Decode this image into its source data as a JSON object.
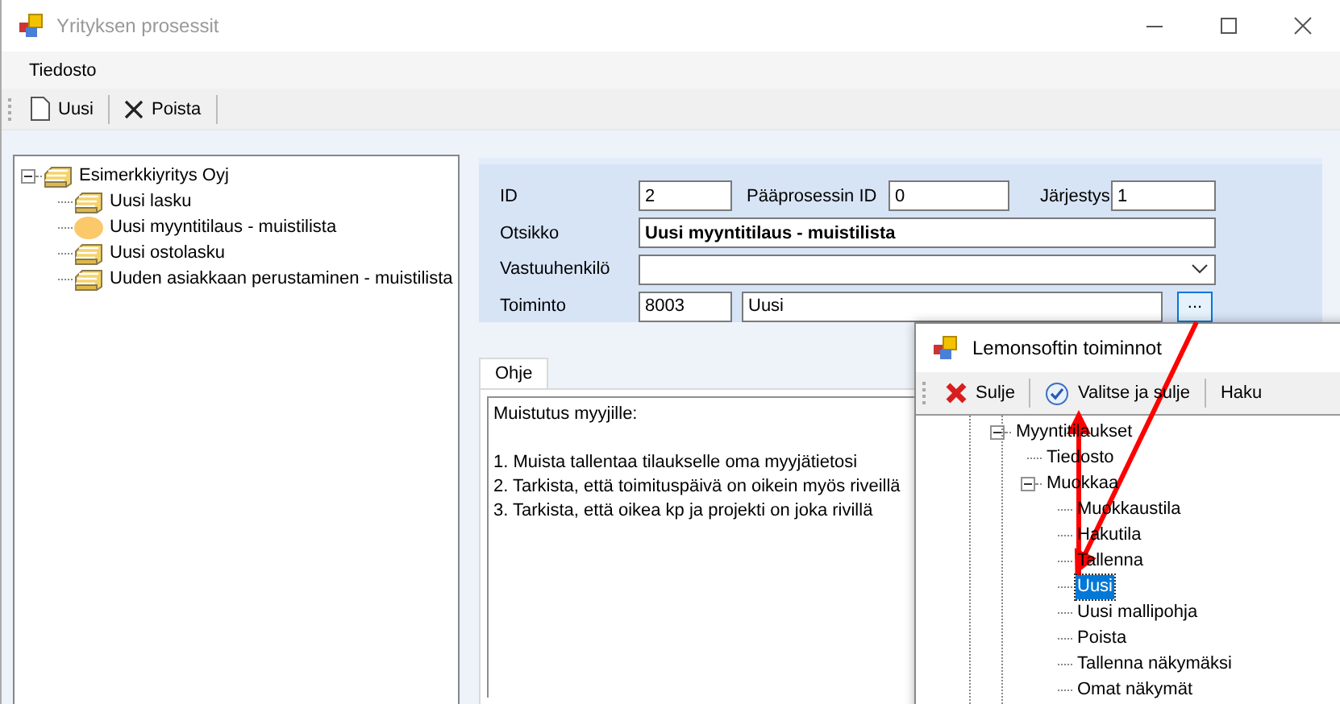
{
  "window": {
    "title": "Yrityksen prosessit"
  },
  "menu": [
    {
      "label": "Tiedosto"
    }
  ],
  "toolbar": [
    {
      "label": "Uusi",
      "kind": "new"
    },
    {
      "label": "Poista",
      "kind": "delete"
    }
  ],
  "tree": [
    {
      "label": "Esimerkkiyritys Oyj",
      "expanded": true,
      "selected": false,
      "children": [
        {
          "label": "Uusi lasku",
          "selected": false
        },
        {
          "label": "Uusi myyntitilaus - muistilista",
          "selected": true
        },
        {
          "label": "Uusi ostolasku",
          "selected": false
        },
        {
          "label": "Uuden asiakkaan perustaminen - muistilista",
          "selected": false
        }
      ]
    }
  ],
  "form": {
    "id": {
      "label": "ID",
      "value": "2"
    },
    "parent_id": {
      "label": "Pääprosessin ID",
      "value": "0"
    },
    "order": {
      "label": "Järjestys",
      "value": "1"
    },
    "title": {
      "label": "Otsikko",
      "value": "Uusi myyntitilaus - muistilista"
    },
    "owner": {
      "label": "Vastuuhenkilö"
    },
    "action": {
      "label": "Toiminto",
      "code": "8003",
      "name": "Uusi",
      "button": "..."
    }
  },
  "tabs": [
    {
      "label": "Ohje",
      "selected": true
    }
  ],
  "help_text": {
    "intro": "Muistutus myyjille:",
    "items": [
      "1. Muista tallentaa tilaukselle oma myyjätietosi",
      "2. Tarkista, että toimituspäivä on oikein myös riveillä",
      "3. Tarkista, että oikea kp ja projekti on joka rivillä"
    ]
  },
  "popup": {
    "title": "Lemonsoftin toiminnot",
    "toolbar": [
      {
        "label": "Sulje",
        "kind": "close"
      },
      {
        "label": "Valitse ja sulje",
        "kind": "confirm"
      },
      {
        "label": "Haku",
        "kind": "text"
      }
    ],
    "tree": [
      {
        "label": "Myyntitilaukset",
        "expanded": true,
        "selected": false,
        "children": [
          {
            "label": "Tiedosto",
            "selected": false
          },
          {
            "label": "Muokkaa",
            "expanded": true,
            "selected": false,
            "children": [
              {
                "label": "Muokkaustila",
                "selected": false
              },
              {
                "label": "Hakutila",
                "selected": false
              },
              {
                "label": "Tallenna",
                "selected": false
              },
              {
                "label": "Uusi",
                "selected": true
              },
              {
                "label": "Uusi mallipohja",
                "selected": false
              },
              {
                "label": "Poista",
                "selected": false
              },
              {
                "label": "Tallenna näkymäksi",
                "selected": false
              },
              {
                "label": "Omat näkymät",
                "selected": false
              }
            ]
          }
        ]
      }
    ]
  }
}
